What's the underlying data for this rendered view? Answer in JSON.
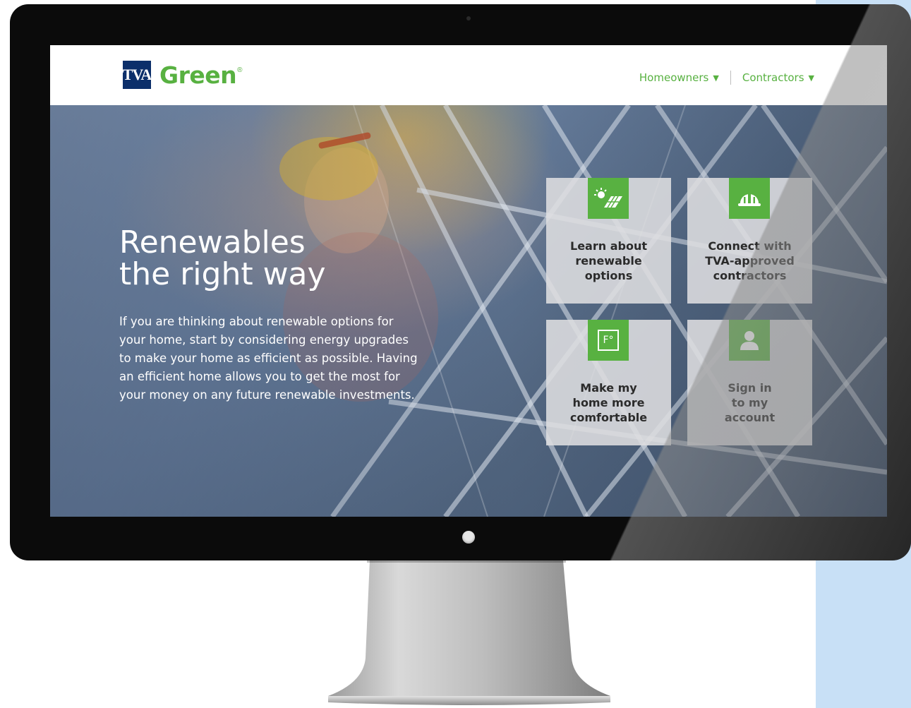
{
  "header": {
    "logo_mark": "TVA",
    "logo_word": "Green",
    "logo_reg": "®",
    "nav": [
      {
        "label": "Homeowners",
        "caret": "▼"
      },
      {
        "label": "Contractors",
        "caret": "▼"
      }
    ]
  },
  "hero": {
    "title_line1": "Renewables",
    "title_line2": "the right way",
    "body": "If you are thinking about renewable options for your home, start by considering energy upgrades to make your home as efficient as possible. Having an efficient home allows you to get the most for your money on any future renewable investments."
  },
  "tiles": [
    {
      "lines": [
        "Learn about",
        "renewable",
        "options"
      ],
      "icon": "solar-panel-icon"
    },
    {
      "lines": [
        "Connect with",
        "TVA-approved",
        "contractors"
      ],
      "icon": "hard-hat-icon"
    },
    {
      "lines": [
        "Make my",
        "home more",
        "comfortable"
      ],
      "icon": "thermostat-icon",
      "icon_text": "F°"
    },
    {
      "lines": [
        "Sign in",
        "to my",
        "account"
      ],
      "icon": "user-icon"
    }
  ],
  "colors": {
    "brand_green": "#58b141",
    "brand_navy": "#0c2f6a",
    "side_panel": "#c8e0f6"
  }
}
